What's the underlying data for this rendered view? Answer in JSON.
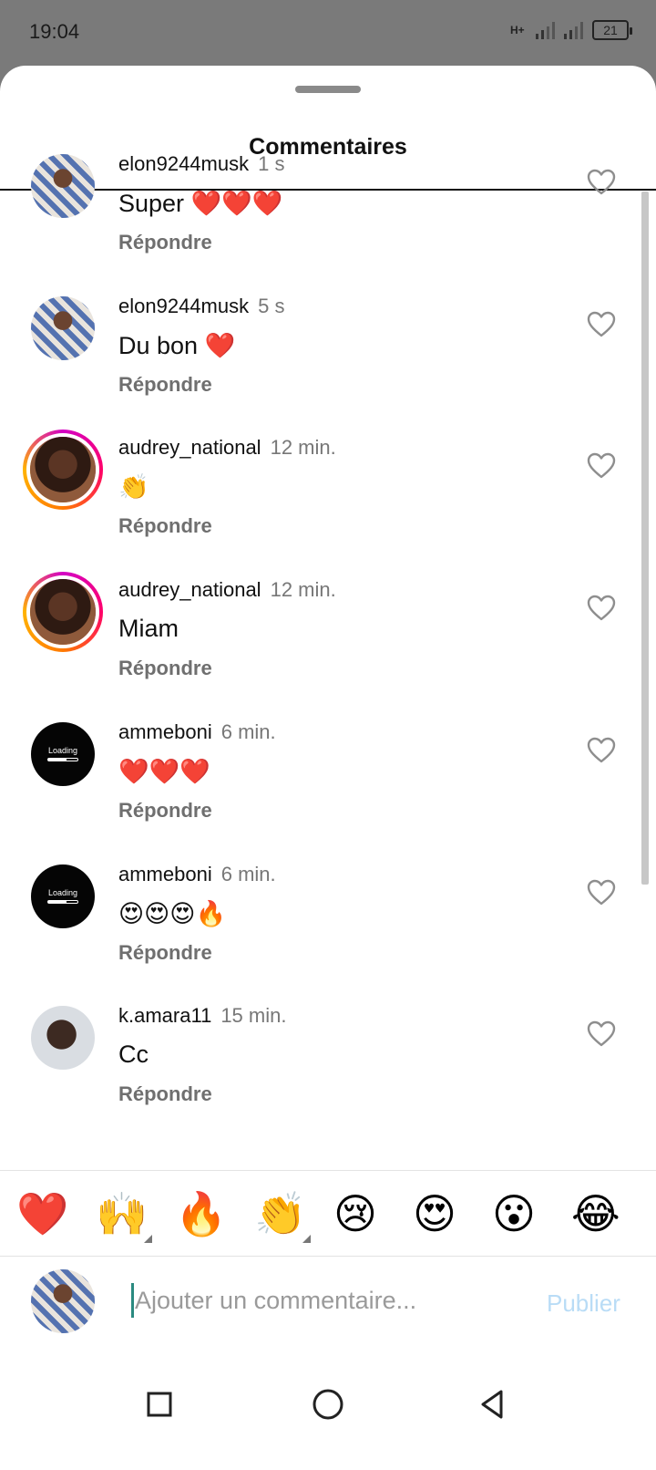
{
  "status_bar": {
    "time": "19:04",
    "network": "H+",
    "battery": "21"
  },
  "sheet": {
    "title": "Commentaires"
  },
  "comments": [
    {
      "username": "elon9244musk",
      "time": "1 s",
      "text": "Super ❤️❤️❤️",
      "reply": "Répondre",
      "avatar": "photo-man"
    },
    {
      "username": "elon9244musk",
      "time": "5 s",
      "text": "Du bon ❤️",
      "reply": "Répondre",
      "avatar": "photo-man"
    },
    {
      "username": "audrey_national",
      "time": "12 min.",
      "text": "👏",
      "reply": "Répondre",
      "avatar": "photo-woman-story"
    },
    {
      "username": "audrey_national",
      "time": "12 min.",
      "text": "Miam",
      "reply": "Répondre",
      "avatar": "photo-woman-story"
    },
    {
      "username": "ammeboni",
      "time": "6 min.",
      "text": "❤️❤️❤️",
      "reply": "Répondre",
      "avatar": "loading"
    },
    {
      "username": "ammeboni",
      "time": "6 min.",
      "text": "😍😍😍🔥",
      "reply": "Répondre",
      "avatar": "loading"
    },
    {
      "username": "k.amara11",
      "time": "15 min.",
      "text": "Cc",
      "reply": "Répondre",
      "avatar": "photo-kamara"
    }
  ],
  "avatar_loading_label": "Loading",
  "emoji_bar": [
    "❤️",
    "🙌",
    "🔥",
    "👏",
    "😢",
    "😍",
    "😮",
    "😂"
  ],
  "composer": {
    "placeholder": "Ajouter un commentaire...",
    "publish_label": "Publier"
  },
  "colors": {
    "publish_disabled": "#b9dcf6",
    "story_ring": "#d300c5"
  },
  "icons": {
    "like": "heart-outline-icon",
    "nav_recent": "square-icon",
    "nav_home": "circle-icon",
    "nav_back": "triangle-back-icon"
  }
}
